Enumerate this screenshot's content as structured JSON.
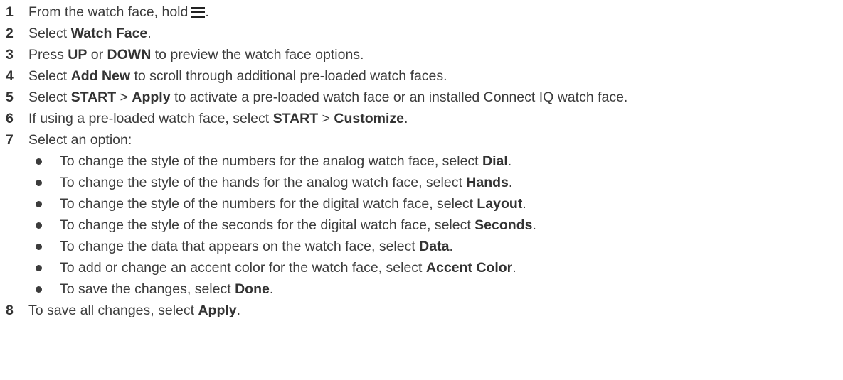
{
  "steps": [
    {
      "num": "1",
      "before": "From the watch face, hold",
      "icon": "menu-icon",
      "after": "."
    },
    {
      "num": "2",
      "a": "Select ",
      "b1": "Watch Face",
      "c": "."
    },
    {
      "num": "3",
      "a": "Press ",
      "b1": "UP",
      "c": " or ",
      "b2": "DOWN",
      "d": " to preview the watch face options."
    },
    {
      "num": "4",
      "a": "Select ",
      "b1": "Add New",
      "c": " to scroll through additional pre-loaded watch faces."
    },
    {
      "num": "5",
      "a": "Select ",
      "b1": "START",
      "c": " > ",
      "b2": "Apply",
      "d": " to activate a pre-loaded watch face or an installed Connect IQ watch face."
    },
    {
      "num": "6",
      "a": "If using a pre-loaded watch face, select ",
      "b1": "START",
      "c": " > ",
      "b2": "Customize",
      "d": "."
    },
    {
      "num": "7",
      "a": "Select an option:"
    },
    {
      "num": "8",
      "a": "To save all changes, select ",
      "b1": "Apply",
      "c": "."
    }
  ],
  "options": [
    {
      "a": "To change the style of the numbers for the analog watch face, select ",
      "b": "Dial",
      "c": "."
    },
    {
      "a": "To change the style of the hands for the analog watch face, select ",
      "b": "Hands",
      "c": "."
    },
    {
      "a": "To change the style of the numbers for the digital watch face, select ",
      "b": "Layout",
      "c": "."
    },
    {
      "a": "To change the style of the seconds for the digital watch face, select ",
      "b": "Seconds",
      "c": "."
    },
    {
      "a": "To change the data that appears on the watch face, select ",
      "b": "Data",
      "c": "."
    },
    {
      "a": "To add or change an accent color for the watch face, select ",
      "b": "Accent Color",
      "c": "."
    },
    {
      "a": "To save the changes, select ",
      "b": "Done",
      "c": "."
    }
  ]
}
